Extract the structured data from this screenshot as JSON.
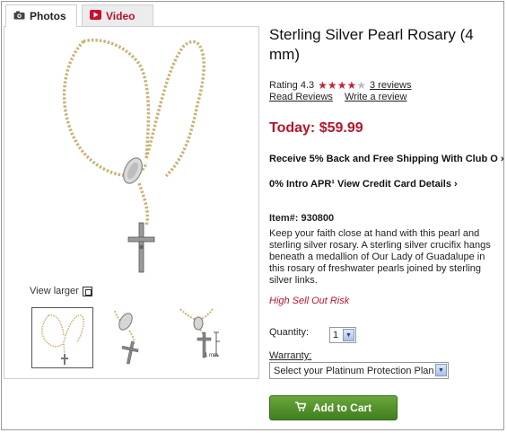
{
  "tabs": [
    {
      "label": "Photos",
      "icon": "camera-icon",
      "selected": true
    },
    {
      "label": "Video",
      "icon": "video-play-icon",
      "selected": false
    }
  ],
  "gallery": {
    "view_larger": "View larger",
    "thumbnails": [
      {
        "name": "rosary-full",
        "selected": true
      },
      {
        "name": "rosary-detail",
        "selected": false
      },
      {
        "name": "rosary-size",
        "selected": false
      }
    ],
    "size_label": "1 mm"
  },
  "product": {
    "title": "Sterling Silver Pearl Rosary (4 mm)",
    "rating_label": "Rating 4.3",
    "rating_value": 4.3,
    "rating_max": 5,
    "reviews_link": "3 reviews",
    "read_reviews": "Read Reviews",
    "write_review": "Write a review",
    "price": "Today: $59.99",
    "promo_1": "Receive 5% Back and Free Shipping With Club O ›",
    "promo_2": "0% Intro APR¹ View Credit Card Details ›",
    "item_number": "Item#: 930800",
    "description": "Keep your faith close at hand with this pearl and sterling silver rosary. A sterling silver crucifix hangs beneath a medallion of Our Lady of Guadalupe in this rosary of freshwater pearls joined by sterling silver links.",
    "stock_note": "High Sell Out Risk"
  },
  "form": {
    "quantity_label": "Quantity:",
    "quantity_value": "1",
    "warranty_label": "Warranty:",
    "warranty_value": "Select your Platinum Protection Plan",
    "add_to_cart": "Add to Cart"
  },
  "colors": {
    "accent_red": "#b5162c",
    "cart_green": "#4f8f2a"
  }
}
